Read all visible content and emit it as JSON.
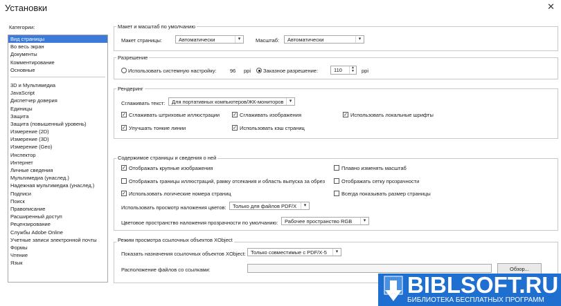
{
  "window": {
    "title": "Установки",
    "close_glyph": "✕"
  },
  "categories": {
    "label": "Категории:",
    "group1": [
      "Вид страницы",
      "Во весь экран",
      "Документы",
      "Комментирование",
      "Основные"
    ],
    "group2": [
      "3D и Мультимедиа",
      "JavaScript",
      "Диспетчер доверия",
      "Единицы",
      "Защита",
      "Защита (повышенный уровень)",
      "Измерение (2D)",
      "Измерение (3D)",
      "Измерение (Geo)",
      "Инспектор",
      "Интернет",
      "Личные сведения",
      "Мультимедиа (унаслед.)",
      "Надежная мультимедиа (унаслед.)",
      "Подписи",
      "Поиск",
      "Правописание",
      "Расширенный доступ",
      "Рецензирование",
      "Службы Adobe Online",
      "Учетные записи электронной почты",
      "Формы",
      "Чтение",
      "Язык"
    ],
    "selected_index": 0
  },
  "layout_section": {
    "title": "Макет и масштаб по умолчанию",
    "page_layout_label": "Макет страницы:",
    "page_layout_value": "Автоматически",
    "zoom_label": "Масштаб:",
    "zoom_value": "Автоматически"
  },
  "resolution_section": {
    "title": "Разрешение",
    "system_label": "Использовать системную настройку:",
    "system_value": "96",
    "system_unit": "ppi",
    "custom_label": "Заказное разрешение:",
    "custom_value": "110",
    "custom_unit": "ppi",
    "selected": "custom"
  },
  "rendering_section": {
    "title": "Рендеринг",
    "smooth_text_label": "Сглаживать текст:",
    "smooth_text_value": "Для портативных компьютеров/ЖК-мониторов",
    "checkboxes": [
      {
        "label": "Сглаживать штриховые иллюстрации",
        "checked": true
      },
      {
        "label": "Сглаживать изображения",
        "checked": true
      },
      {
        "label": "Использовать локальные шрифты",
        "checked": true
      },
      {
        "label": "Улучшать тонкие линии",
        "checked": true
      },
      {
        "label": "Использовать кэш страниц",
        "checked": true
      }
    ]
  },
  "content_section": {
    "title": "Содержимое страницы и сведения о ней",
    "checkboxes": [
      {
        "label": "Отображать крупные изображения",
        "checked": true
      },
      {
        "label": "Плавно изменять масштаб",
        "checked": false
      },
      {
        "label": "Отображать границы иллюстраций, рамку отсекания и область выпуска за обрез",
        "checked": false
      },
      {
        "label": "Отображать сетку прозрачности",
        "checked": false
      },
      {
        "label": "Использовать логические номера страниц",
        "checked": true
      },
      {
        "label": "Всегда показывать размер страницы",
        "checked": false
      }
    ],
    "overprint_label": "Использовать просмотр наложения цветов:",
    "overprint_value": "Только для файлов PDF/X",
    "blend_label": "Цветовое пространство наложения прозрачности по умолчанию:",
    "blend_value": "Рабочее пространство RGB"
  },
  "xobject_section": {
    "title": "Режим просмотра ссылочных объектов XObject",
    "show_label": "Показать назначения ссылочных объектов XObject:",
    "show_value": "Только совместимые с PDF/X-5",
    "location_label": "Расположение файлов со ссылками:",
    "location_value": "",
    "browse_label": "Обзор..."
  },
  "watermark": {
    "title": "BIBLSOFT.RU",
    "subtitle": "БИБЛИОТЕКА БЕСПЛАТНЫХ ПРОГРАММ"
  },
  "colors": {
    "selection": "#3b7ad9",
    "watermark_bg": "#1f6fd1"
  }
}
